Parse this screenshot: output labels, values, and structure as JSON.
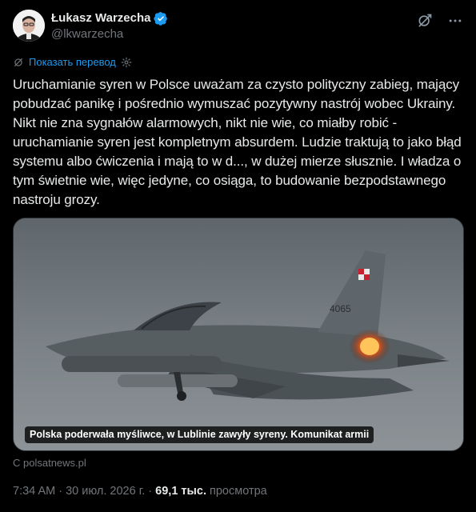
{
  "author": {
    "display_name": "Łukasz Warzecha",
    "handle": "@lkwarzecha"
  },
  "icons": {
    "verified": "verified-badge-icon",
    "grok": "grok-icon",
    "more": "more-icon",
    "translate": "translate-icon",
    "settings": "gear-icon"
  },
  "translate": {
    "label": "Показать перевод"
  },
  "tweet": {
    "text": "Uruchamianie syren w Polsce uważam za czysto polityczny zabieg, mający pobudzać panikę i pośrednio wymuszać pozytywny nastrój wobec Ukrainy. Nikt nie zna sygnałów alarmowych, nikt nie wie, co miałby robić - uruchamianie syren jest kompletnym absurdem. Ludzie traktują to jako błąd systemu albo ćwiczenia i mają to w d..., w dużej mierze słusznie. I władza o tym świetnie wie, więc jedyne, co osiąga, to budowanie bezpodstawnego nastroju grozy."
  },
  "card": {
    "caption": "Polska poderwała myśliwce, w Lublinie zawyły syreny. Komunikat armii",
    "source": "С polsatnews.pl",
    "tail_number": "4065"
  },
  "meta": {
    "time": "7:34 AM",
    "sep1": " · ",
    "date": "30 июл. 2026 г.",
    "sep2": " · ",
    "views_count": "69,1 тыс.",
    "views_label": " просмотра"
  },
  "colors": {
    "background": "#000000",
    "text": "#e7e9ea",
    "muted": "#71767b",
    "link": "#1d9bf0",
    "verified": "#1d9bf0",
    "border": "#2f3336"
  }
}
